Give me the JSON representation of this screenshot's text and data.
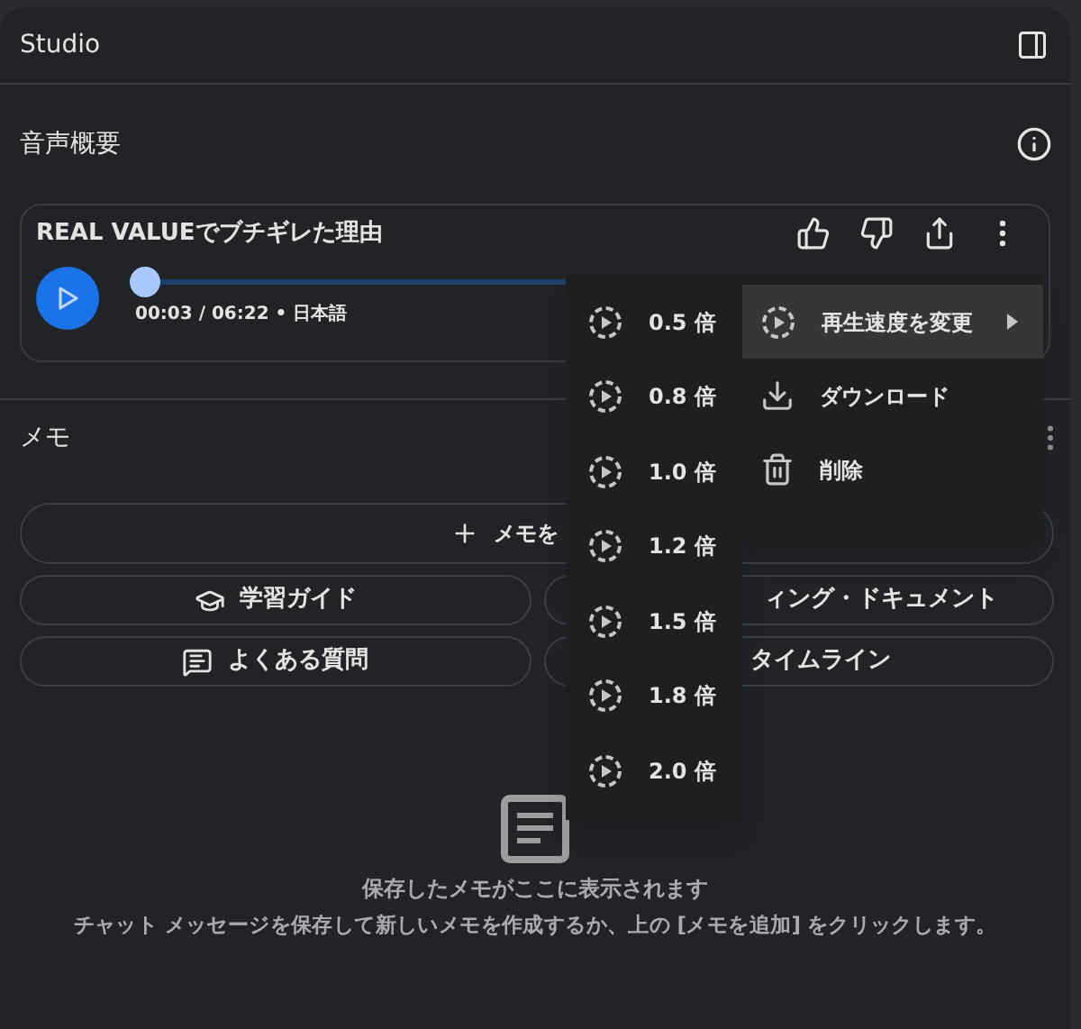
{
  "header": {
    "title": "Studio"
  },
  "audio_overview": {
    "title": "音声概要",
    "card": {
      "title": "REAL VALUEでブチギレた理由",
      "time": "00:03 / 06:22 • 日本語",
      "level": 0.01
    }
  },
  "memo": {
    "title": "メモ",
    "add_button": {
      "label": "メモを"
    },
    "note_buttons": [
      {
        "label": "学習ガイド",
        "kind": "study"
      },
      {
        "label": "ィング・ドキュメント",
        "kind": "covered-end"
      },
      {
        "label": "よくある質問",
        "kind": "faq"
      },
      {
        "label": "タイムライン",
        "kind": "covered-start"
      }
    ],
    "empty_state": {
      "title": "保存したメモがここに表示されます",
      "text": "チャット メッセージを保存して新しいメモを作成するか、上の [メモを追加] をクリックします。"
    }
  },
  "speed_menu": [
    {
      "label": "0.5 倍"
    },
    {
      "label": "0.8 倍"
    },
    {
      "label": "1.0 倍"
    },
    {
      "label": "1.2 倍"
    },
    {
      "label": "1.5 倍"
    },
    {
      "label": "1.8 倍"
    },
    {
      "label": "2.0 倍"
    }
  ],
  "context_menu": [
    {
      "label": "再生速度を変更",
      "kind": "speed",
      "selected": true
    },
    {
      "label": "ダウンロード",
      "kind": "download",
      "selected": false
    },
    {
      "label": "削除",
      "kind": "delete",
      "selected": false
    }
  ]
}
